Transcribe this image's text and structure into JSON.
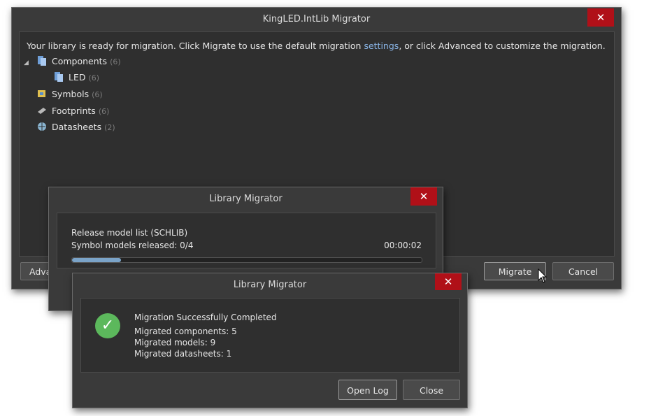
{
  "main_window": {
    "title": "KingLED.IntLib Migrator",
    "message_before": "Your library is ready for migration. Click Migrate to use the default migration ",
    "message_link": "settings",
    "message_after": ", or click Advanced to customize the migration.",
    "tree": [
      {
        "label": "Components",
        "count": "(6)",
        "icon": "component-icon",
        "expanded": true
      },
      {
        "label": "LED",
        "count": "(6)",
        "icon": "component-icon"
      },
      {
        "label": "Symbols",
        "count": "(6)",
        "icon": "symbol-icon"
      },
      {
        "label": "Footprints",
        "count": "(6)",
        "icon": "footprint-icon"
      },
      {
        "label": "Datasheets",
        "count": "(2)",
        "icon": "datasheet-icon"
      }
    ],
    "advanced_label_partial": "Adva",
    "migrate_label": "Migrate",
    "cancel_label": "Cancel",
    "close_glyph": "✕"
  },
  "progress_dialog": {
    "title": "Library Migrator",
    "line1": "Release model list (SCHLIB)",
    "line2": "Symbol models released: 0/4",
    "elapsed": "00:00:02",
    "progress": 0.14,
    "close_glyph": "✕"
  },
  "result_dialog": {
    "title": "Library Migrator",
    "heading": "Migration Successfully Completed",
    "lines": [
      "Migrated components: 5",
      "Migrated models: 9",
      "Migrated datasheets: 1"
    ],
    "open_log_label": "Open Log",
    "close_label": "Close",
    "check_glyph": "✓",
    "close_glyph": "✕"
  },
  "colors": {
    "window_bg": "#3a3a3a",
    "close_red": "#b01018",
    "success_green": "#5cb85c",
    "link_blue": "#8ab6e8",
    "progress_fill": "#7aa3c8"
  }
}
